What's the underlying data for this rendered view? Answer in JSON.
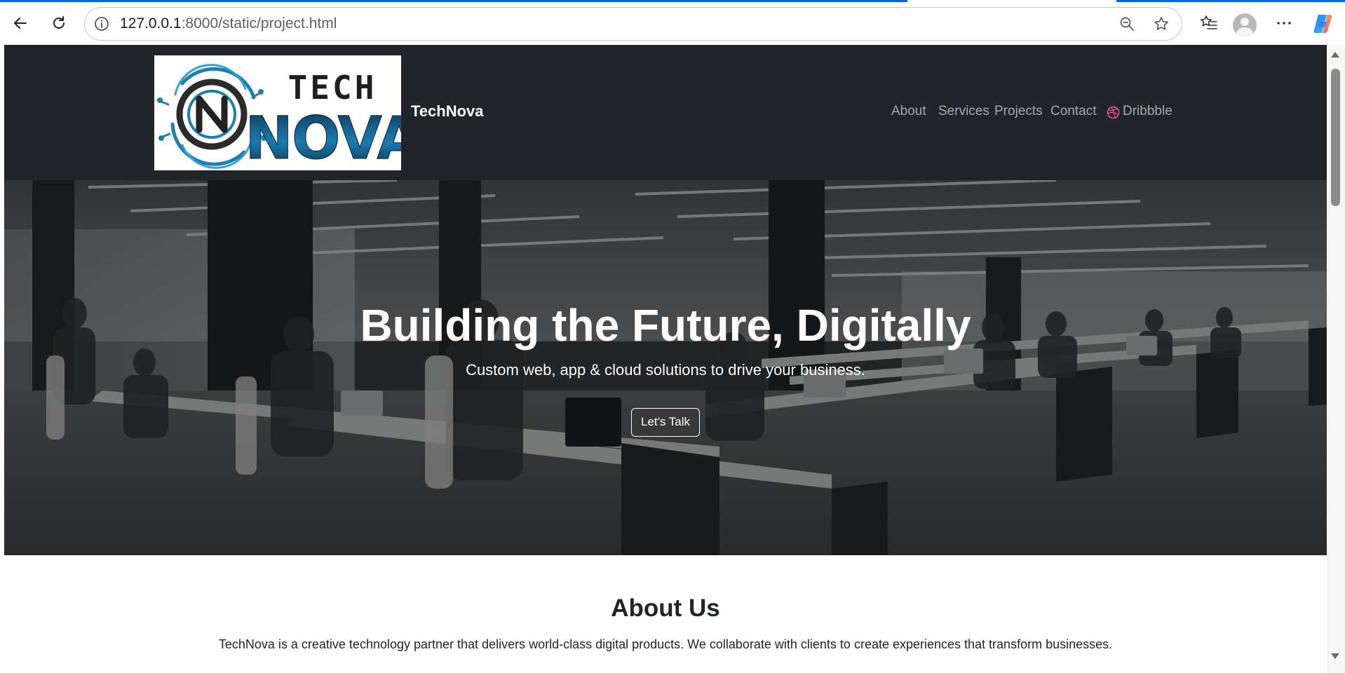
{
  "browser": {
    "url_host": "127.0.0.1",
    "url_path": ":8000/static/project.html",
    "icons": [
      "back-arrow-icon",
      "reload-icon",
      "site-info-icon",
      "zoom-out-icon",
      "favorite-star-icon",
      "favorites-list-icon",
      "profile-avatar-icon",
      "more-menu-icon",
      "copilot-icon"
    ],
    "accent_color": "#0a68d6"
  },
  "site": {
    "logo": {
      "line1": "TECH",
      "line2": "NOVA"
    },
    "brand": "TechNova",
    "nav": {
      "items": [
        "About",
        "Services",
        "Projects",
        "Contact"
      ],
      "dribbble": "Dribbble",
      "dribbble_color": "#ea4c89"
    },
    "hero": {
      "title": "Building the Future, Digitally",
      "subtitle": "Custom web, app & cloud solutions to drive your business.",
      "cta": "Let's Talk"
    },
    "about": {
      "title": "About Us",
      "text": "TechNova is a creative technology partner that delivers world-class digital products. We collaborate with clients to create experiences that transform businesses."
    },
    "colors": {
      "navbar": "#212529",
      "text_dark": "#212529"
    }
  }
}
